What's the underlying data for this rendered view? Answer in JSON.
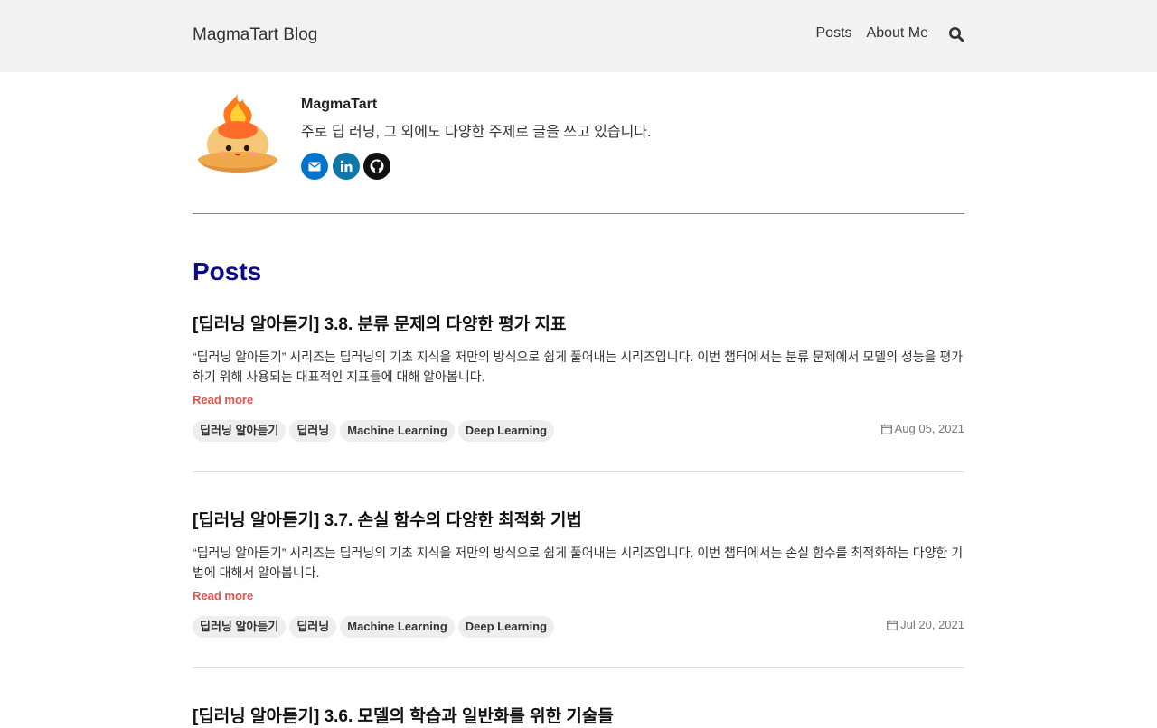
{
  "navbar": {
    "brand": "MagmaTart Blog",
    "links": [
      "Posts",
      "About Me"
    ]
  },
  "profile": {
    "name": "MagmaTart",
    "bio": "주로 딥 러닝, 그 외에도 다양한 주제로 글을 쓰고 있습니다.",
    "socials": [
      "mail-icon",
      "linkedin-icon",
      "github-icon"
    ]
  },
  "posts_heading": "Posts",
  "posts": [
    {
      "title": "[딥러닝 알아듣기] 3.8. 분류 문제의 다양한 평가 지표",
      "excerpt": "“딥러닝 알아듣기” 시리즈는 딥러닝의 기초 지식을 저만의 방식으로 쉽게 풀어내는 시리즈입니다. 이번 챕터에서는 분류 문제에서 모델의 성능을 평가하기 위해 사용되는 대표적인 지표들에 대해 알아봅니다.",
      "read_more": "Read more",
      "tags": [
        "딥러닝 알아듣기",
        "딥러닝",
        "Machine Learning",
        "Deep Learning"
      ],
      "date": "Aug 05, 2021"
    },
    {
      "title": "[딥러닝 알아듣기] 3.7. 손실 함수의 다양한 최적화 기법",
      "excerpt": "“딥러닝 알아듣기” 시리즈는 딥러닝의 기초 지식을 저만의 방식으로 쉽게 풀어내는 시리즈입니다. 이번 챕터에서는 손실 함수를 최적화하는 다양한 기법에 대해서 알아봅니다.",
      "read_more": "Read more",
      "tags": [
        "딥러닝 알아듣기",
        "딥러닝",
        "Machine Learning",
        "Deep Learning"
      ],
      "date": "Jul 20, 2021"
    },
    {
      "title": "[딥러닝 알아듣기] 3.6. 모델의 학습과 일반화를 위한 기술들"
    }
  ],
  "colors": {
    "navbar_bg": "#f2f2f2",
    "heading": "#0a0a8a",
    "read_more": "#e0524a",
    "tag_bg": "#eeeeee"
  }
}
